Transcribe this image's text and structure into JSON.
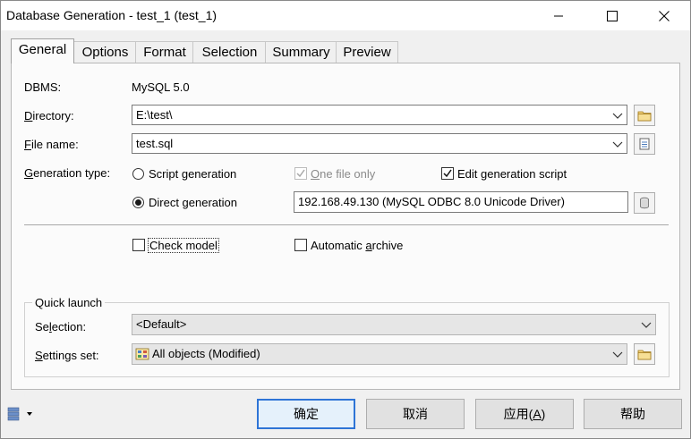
{
  "window": {
    "title": "Database Generation - test_1 (test_1)"
  },
  "tabs": [
    {
      "label": "General",
      "active": true
    },
    {
      "label": "Options",
      "active": false
    },
    {
      "label": "Format",
      "active": false
    },
    {
      "label": "Selection",
      "active": false
    },
    {
      "label": "Summary",
      "active": false
    },
    {
      "label": "Preview",
      "active": false
    }
  ],
  "general": {
    "dbms_label": "DBMS:",
    "dbms_value": "MySQL 5.0",
    "directory_label_mnemonic": "D",
    "directory_label_rest": "irectory:",
    "directory_value": "E:\\test\\",
    "filename_label_mnemonic": "F",
    "filename_label_rest": "ile name:",
    "filename_value": "test.sql",
    "gentype_label_mnemonic": "G",
    "gentype_label_rest": "eneration type:",
    "script_generation": "Script generation",
    "one_file_only_mnemonic": "O",
    "one_file_only_rest": "ne file only",
    "edit_script": "Edit generation script",
    "direct_generation": "Direct generation",
    "datasource_value": "192.168.49.130 (MySQL ODBC 8.0 Unicode Driver)",
    "check_model": "Check model",
    "auto_archive_pre": "Automatic ",
    "auto_archive_mnemonic": "a",
    "auto_archive_rest": "rchive",
    "radio_direct_selected": true,
    "edit_script_checked": true,
    "one_file_only_checked": true,
    "check_model_checked": false,
    "auto_archive_checked": false
  },
  "quick_launch": {
    "title": "Quick launch",
    "selection_label_pre": "Se",
    "selection_label_mnemonic": "l",
    "selection_label_rest": "ection:",
    "selection_value": "<Default>",
    "settings_label_mnemonic": "S",
    "settings_label_rest": "ettings set:",
    "settings_value": "All objects (Modified)"
  },
  "buttons": {
    "ok": "确定",
    "cancel": "取消",
    "apply_pre": "应用(",
    "apply_mnemonic": "A",
    "apply_post": ")",
    "help": "帮助"
  },
  "colors": {
    "default_button_border": "#2e74d6",
    "panel_background": "#fbfbfb",
    "dialog_background": "#f0f0f0"
  },
  "icons": {
    "minimize": "minimize-icon",
    "maximize": "maximize-icon",
    "close": "close-icon",
    "browse_folder": "folder-icon",
    "browse_file": "file-icon",
    "datasource": "database-icon",
    "settings": "settings-set-icon",
    "menu": "dialog-menu-icon"
  }
}
